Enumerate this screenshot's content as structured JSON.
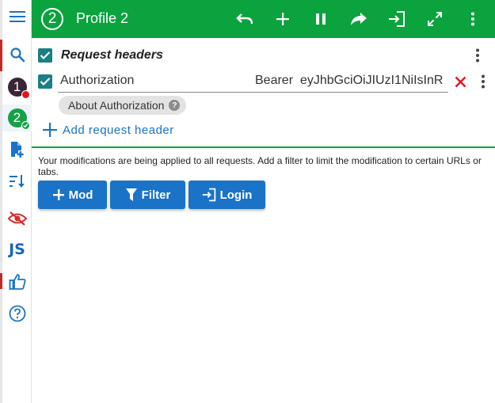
{
  "topbar": {
    "profile_number": "2",
    "profile_title": "Profile 2",
    "icons": [
      "undo-icon",
      "add-icon",
      "pause-icon",
      "redo-icon",
      "login-icon",
      "fullscreen-icon",
      "more-vert-icon"
    ]
  },
  "sidebar": {
    "items": [
      {
        "icon": "menu-icon"
      },
      {
        "icon": "search-icon"
      },
      {
        "label": "1",
        "icon": "profile-1-badge",
        "status_color": "#e3141e"
      },
      {
        "label": "2",
        "icon": "profile-2-badge",
        "status_color": "#18a048"
      },
      {
        "icon": "add-file-icon"
      },
      {
        "icon": "sort-icon"
      },
      {
        "icon": "eye-off-icon"
      },
      {
        "label": "JS",
        "icon": "js-icon"
      },
      {
        "icon": "thumbs-up-icon"
      },
      {
        "icon": "help-icon"
      }
    ]
  },
  "request_headers": {
    "title": "Request headers",
    "rows": [
      {
        "name": "Authorization",
        "value": "Bearer  eyJhbGciOiJIUzI1NiIsInR",
        "enabled": true
      }
    ],
    "chip_label": "About Authorization",
    "add_label": "Add request header"
  },
  "info": {
    "text": "Your modifications are being applied to all requests. Add a filter to limit the modification to certain URLs or tabs."
  },
  "buttons": {
    "mod": "Mod",
    "filter": "Filter",
    "login": "Login"
  },
  "colors": {
    "accent_green": "#0aa33e",
    "button_blue": "#1a73c7",
    "delete_red": "#e3141e",
    "checkbox_teal": "#1a7f86"
  }
}
